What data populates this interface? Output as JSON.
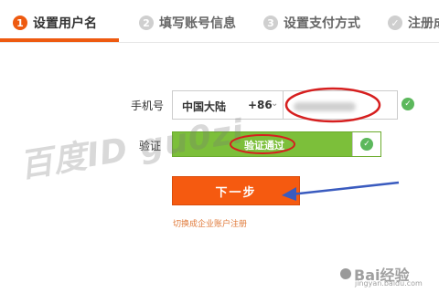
{
  "steps": [
    {
      "num": "1",
      "label": "设置用户名"
    },
    {
      "num": "2",
      "label": "填写账号信息"
    },
    {
      "num": "3",
      "label": "设置支付方式"
    },
    {
      "num": "✓",
      "label": "注册成"
    }
  ],
  "form": {
    "phone_label": "手机号",
    "region_name": "中国大陆",
    "region_code": "+86",
    "phone_value": "",
    "verify_label": "验证",
    "verify_status": "验证通过",
    "next_button": "下一步",
    "switch_link": "切换成企业账户注册"
  },
  "watermark": "百度ID gu0zi",
  "footer_logo": {
    "text": "Bai经验",
    "url": "jingyan.baidu.com"
  },
  "icons": {
    "phone_ok": "check-circle-icon",
    "verify_ok": "check-circle-icon",
    "region_dropdown": "chevron-down-icon"
  },
  "colors": {
    "accent": "#ee5a10",
    "button": "#f55a10",
    "success": "#7cbf3a",
    "check": "#5cb85c",
    "annotation_red": "#d61f1f",
    "annotation_blue": "#3a5bbf"
  }
}
